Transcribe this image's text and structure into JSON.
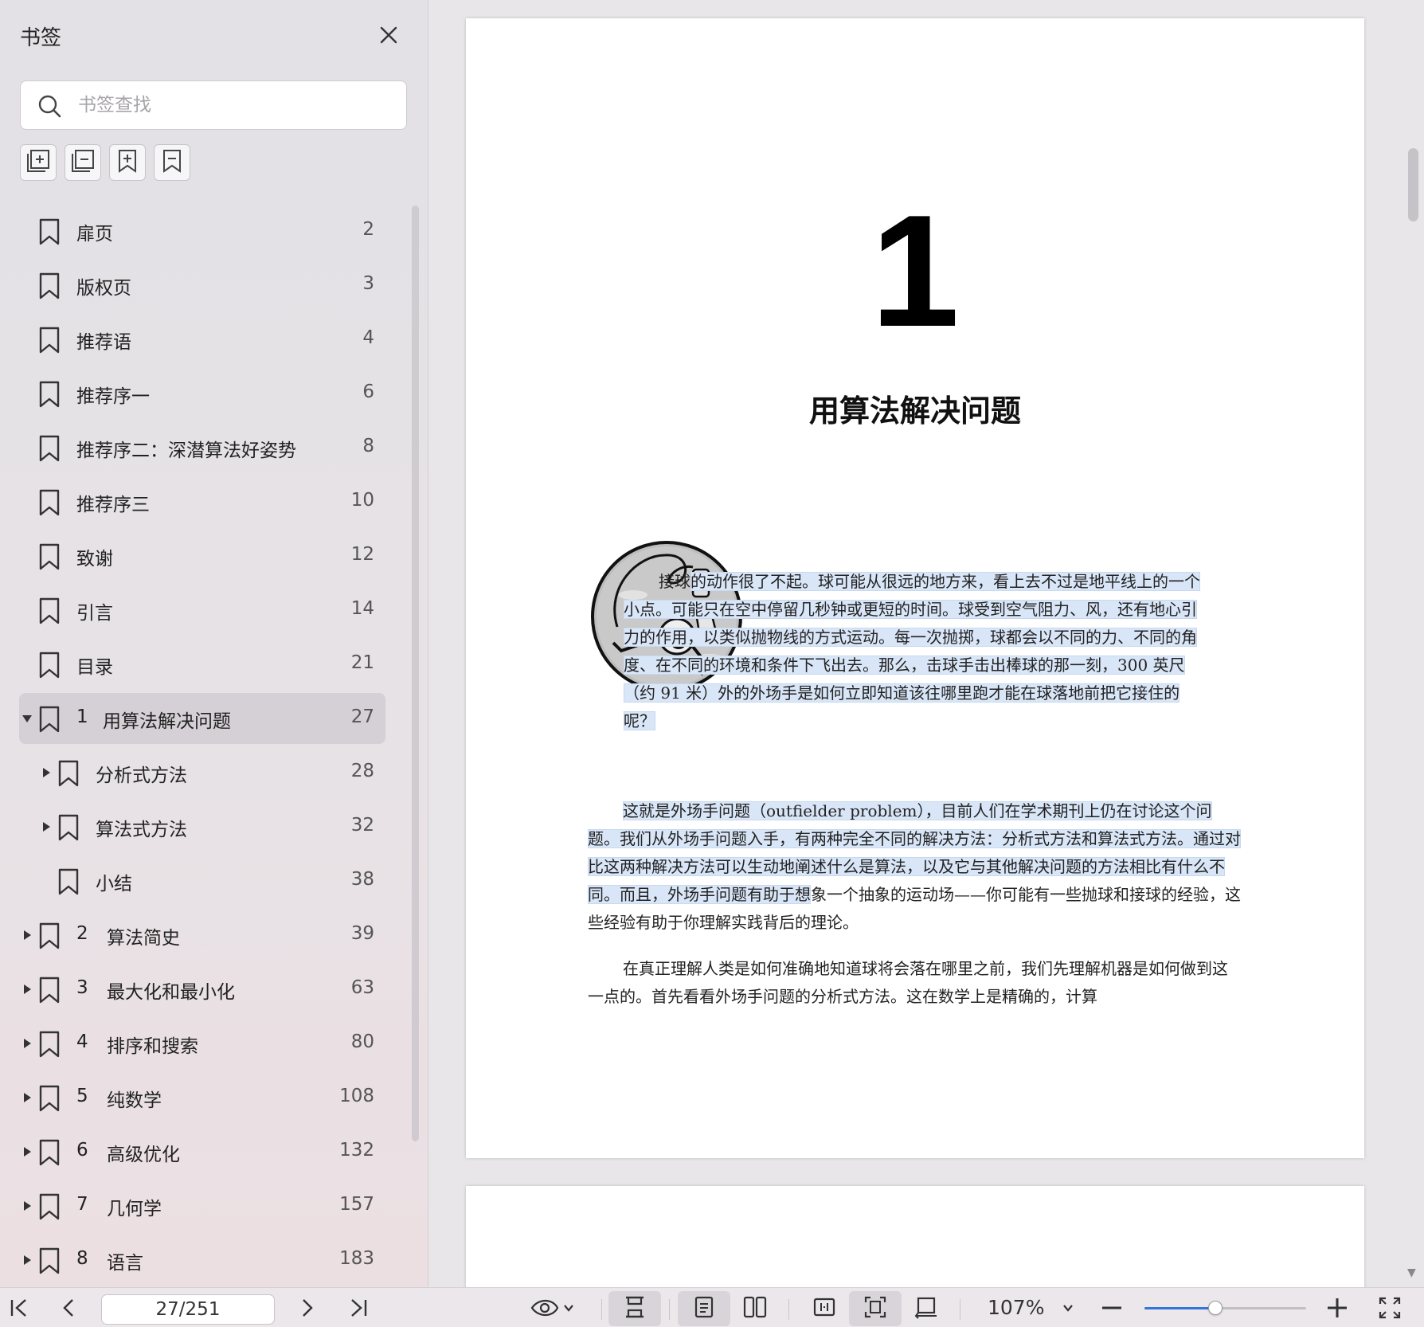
{
  "sidebar": {
    "title": "书签",
    "search_placeholder": "书签查找",
    "toolbar": [
      "expand-all-icon",
      "collapse-all-icon",
      "add-bookmark-icon",
      "bookmark-icon"
    ],
    "items": [
      {
        "num": "",
        "label": "扉页",
        "page": "2",
        "level": 0,
        "arrow": "none"
      },
      {
        "num": "",
        "label": "版权页",
        "page": "3",
        "level": 0,
        "arrow": "none"
      },
      {
        "num": "",
        "label": "推荐语",
        "page": "4",
        "level": 0,
        "arrow": "none"
      },
      {
        "num": "",
        "label": "推荐序一",
        "page": "6",
        "level": 0,
        "arrow": "none"
      },
      {
        "num": "",
        "label": "推荐序二：深潜算法好姿势",
        "page": "8",
        "level": 0,
        "arrow": "none"
      },
      {
        "num": "",
        "label": "推荐序三",
        "page": "10",
        "level": 0,
        "arrow": "none"
      },
      {
        "num": "",
        "label": "致谢",
        "page": "12",
        "level": 0,
        "arrow": "none"
      },
      {
        "num": "",
        "label": "引言",
        "page": "14",
        "level": 0,
        "arrow": "none"
      },
      {
        "num": "",
        "label": "目录",
        "page": "21",
        "level": 0,
        "arrow": "none"
      },
      {
        "num": "1",
        "label": "用算法解决问题",
        "page": "27",
        "level": 0,
        "arrow": "down",
        "active": true
      },
      {
        "num": "",
        "label": "分析式方法",
        "page": "28",
        "level": 1,
        "arrow": "right"
      },
      {
        "num": "",
        "label": "算法式方法",
        "page": "32",
        "level": 1,
        "arrow": "right"
      },
      {
        "num": "",
        "label": "小结",
        "page": "38",
        "level": 1,
        "arrow": "none"
      },
      {
        "num": "2",
        "label": "算法简史",
        "page": "39",
        "level": 0,
        "arrow": "right"
      },
      {
        "num": "3",
        "label": "最大化和最小化",
        "page": "63",
        "level": 0,
        "arrow": "right"
      },
      {
        "num": "4",
        "label": "排序和搜索",
        "page": "80",
        "level": 0,
        "arrow": "right"
      },
      {
        "num": "5",
        "label": "纯数学",
        "page": "108",
        "level": 0,
        "arrow": "right"
      },
      {
        "num": "6",
        "label": "高级优化",
        "page": "132",
        "level": 0,
        "arrow": "right"
      },
      {
        "num": "7",
        "label": "几何学",
        "page": "157",
        "level": 0,
        "arrow": "right"
      },
      {
        "num": "8",
        "label": "语言",
        "page": "183",
        "level": 0,
        "arrow": "right"
      }
    ]
  },
  "document": {
    "chapter_number": "1",
    "chapter_title": "用算法解决问题",
    "para1_plain": "接球",
    "para1_highlight": "的动作很了不起。球可能从很远的地方来，看上去不过是地平线上的一个小点。可能只在空中停留几秒钟或更短的时间。球受到空气阻力、风，还有地心引力的作用，以类似抛物线的方式运动。每一次抛掷，球都会以不同的力、不同的角度、在不同的环境和条件下飞出去。那么，击球手击出棒球的那一刻，300 英尺（约 91 米）外的外场手是如何立即知道该往哪里跑才能在球落地前把它接住的呢？",
    "para2_highlight": "这就是外场手问题（outfielder problem），目前人们在学术期刊上仍在讨论这个问题。我们从外场手问题入手，有两种完全不同的解决方法：分析式方法和算法式方法。通过对比这两种解决方法可以生动地阐述什么是算法，以及它与其他解决问题的方法相比有什么不同。而且，外场手问题有助于想",
    "para2_plain": "象一个抽象的运动场——你可能有一些抛球和接球的经验，这些经验有助于你理解实践背后的理论。",
    "para3": "在真正理解人类是如何准确地知道球将会落在哪里之前，我们先理解机器是如何做到这一点的。首先看看外场手问题的分析式方法。这在数学上是精确的，计算"
  },
  "bottombar": {
    "page_indicator": "27/251",
    "zoom": "107%",
    "zoom_fraction": 0.44,
    "nav_icons": [
      "first-page-icon",
      "prev-page-icon",
      "next-page-icon",
      "last-page-icon"
    ],
    "view_icons": [
      "eye-icon",
      "continuous-scroll-icon",
      "single-page-icon",
      "two-page-icon",
      "fit-width-icon",
      "fit-page-icon",
      "rotate-icon"
    ]
  },
  "colors": {
    "highlight": "#d9e6f7",
    "active_item": "#d5d0d6",
    "accent": "#3476d8"
  }
}
